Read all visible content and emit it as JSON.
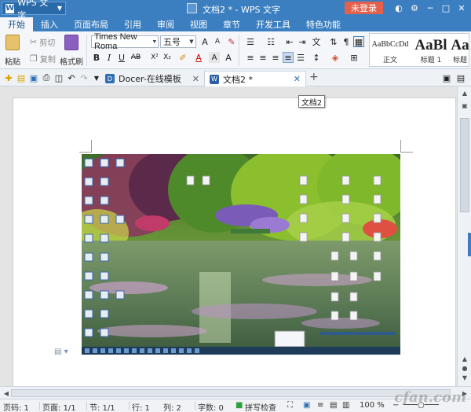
{
  "window": {
    "app_button": "WPS 文字",
    "title": "文档2 * - WPS 文字",
    "login_button": "未登录"
  },
  "menu": [
    "开始",
    "插入",
    "页面布局",
    "引用",
    "审阅",
    "视图",
    "章节",
    "开发工具",
    "特色功能"
  ],
  "ribbon": {
    "paste": "粘贴",
    "cut": "剪切",
    "copy": "复制",
    "format_painter": "格式刷",
    "font_name": "Times New Roma",
    "font_size": "五号",
    "styles": [
      {
        "sample": "AaBbCcDd",
        "name": "正文"
      },
      {
        "sample": "AaBl",
        "name": "标题 1"
      },
      {
        "sample": "Aa",
        "name": "标题"
      }
    ]
  },
  "tabs": [
    {
      "label": "Docer-在线模板",
      "icon": "docer-icon"
    },
    {
      "label": "文档2 *",
      "icon": "wps-doc-icon"
    }
  ],
  "tooltip": "文档2",
  "status": {
    "page_no": "页码: 1",
    "pages": "页面: 1/1",
    "section": "节: 1/1",
    "row": "行: 1",
    "col": "列: 2",
    "words": "字数: 0",
    "spell": "拼写检查",
    "zoom": "100 %"
  },
  "watermark": "cfan.com"
}
